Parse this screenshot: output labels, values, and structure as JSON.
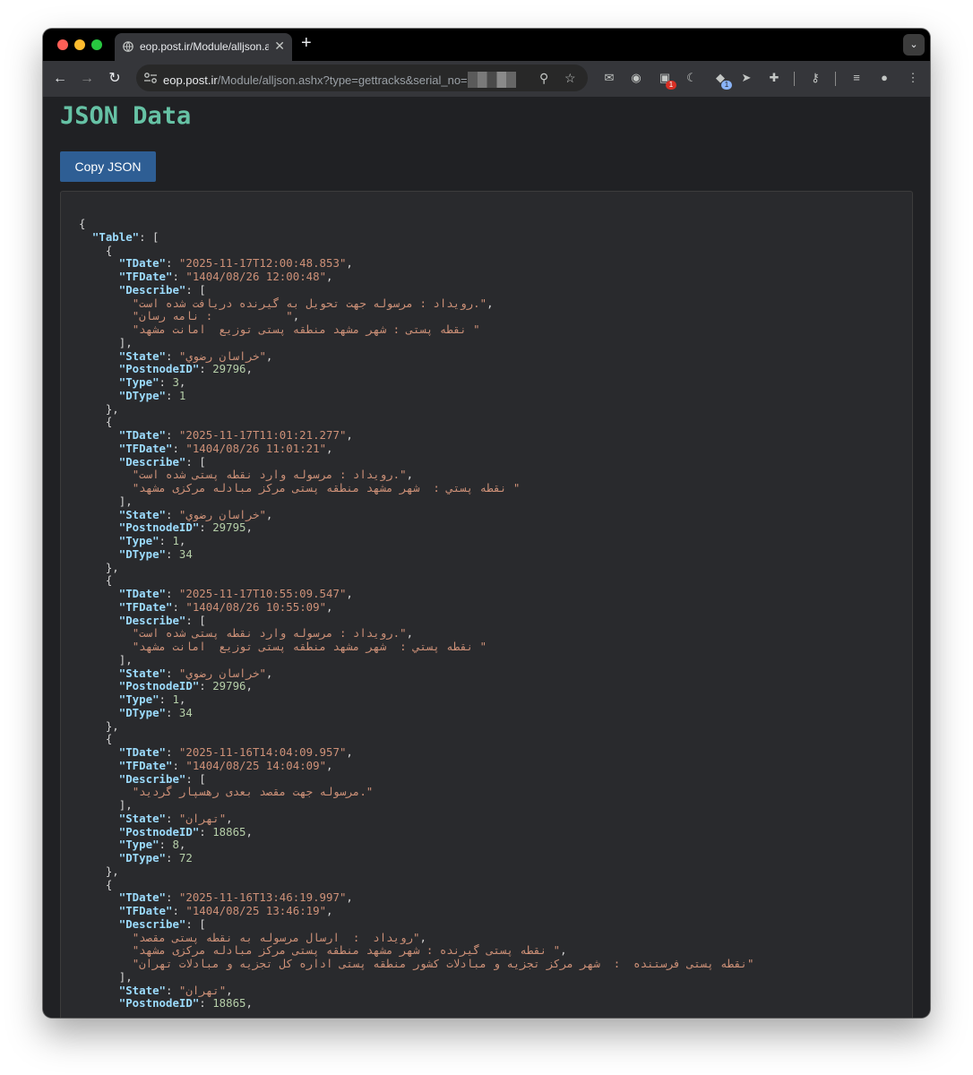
{
  "browser": {
    "tab_title": "eop.post.ir/Module/alljson.ashx",
    "url_host": "eop.post.ir",
    "url_path": "/Module/alljson.ashx?type=gettracks&serial_no=",
    "badge_red": "1",
    "badge_blue": "1"
  },
  "page": {
    "title": "JSON Data",
    "copy_label": "Copy JSON"
  },
  "json": {
    "root_open": "{",
    "table_key": "\"Table\"",
    "entries": [
      {
        "tdate": "\"2025-11-17T12:00:48.853\"",
        "tfdate": "\"1404/08/26 12:00:48\"",
        "describe": [
          "\"رویداد : مرسوله جهت تحویل به گیرنده دریافت شده است.\"",
          "\"نامه رسان :           \"",
          "\"نقطه پستی : شهر مشهد منطقه پستی توزیع  امانت مشهد \""
        ],
        "state": "\"خراسان رضوي\"",
        "postnode": "29796",
        "type": "3",
        "dtype": "1"
      },
      {
        "tdate": "\"2025-11-17T11:01:21.277\"",
        "tfdate": "\"1404/08/26 11:01:21\"",
        "describe": [
          "\"رویداد : مرسوله وارد نقطه پستی شده است.\"",
          "\"نقطه پستي :  شهر مشهد منطقه پستی مرکز مبادله مرکزی مشهد \""
        ],
        "state": "\"خراسان رضوي\"",
        "postnode": "29795",
        "type": "1",
        "dtype": "34"
      },
      {
        "tdate": "\"2025-11-17T10:55:09.547\"",
        "tfdate": "\"1404/08/26 10:55:09\"",
        "describe": [
          "\"رویداد : مرسوله وارد نقطه پستی شده است.\"",
          "\"نقطه پستي :  شهر مشهد منطقه پستی توزیع  امانت مشهد \""
        ],
        "state": "\"خراسان رضوي\"",
        "postnode": "29796",
        "type": "1",
        "dtype": "34"
      },
      {
        "tdate": "\"2025-11-16T14:04:09.957\"",
        "tfdate": "\"1404/08/25 14:04:09\"",
        "describe": [
          "\"مرسوله جهت مقصد بعدی رهسپار گردید.\""
        ],
        "state": "\"تهران\"",
        "postnode": "18865",
        "type": "8",
        "dtype": "72"
      },
      {
        "tdate": "\"2025-11-16T13:46:19.997\"",
        "tfdate": "\"1404/08/25 13:46:19\"",
        "describe": [
          "\"رویداد  :  ارسال مرسوله به نقطه پستی مقصد\"",
          "\"نقطه پستی گیرنده : شهر مشهد منطقه پستی مرکز مبادله مرکزی مشهد \"",
          "\"نقطه پستی فرستنده  :  شهر مرکز تجزیه و مبادلات کشور منطقه پستی اداره کل تجزیه و مبادلات تهران\""
        ],
        "state": "\"تهران\"",
        "postnode": "18865"
      }
    ]
  }
}
